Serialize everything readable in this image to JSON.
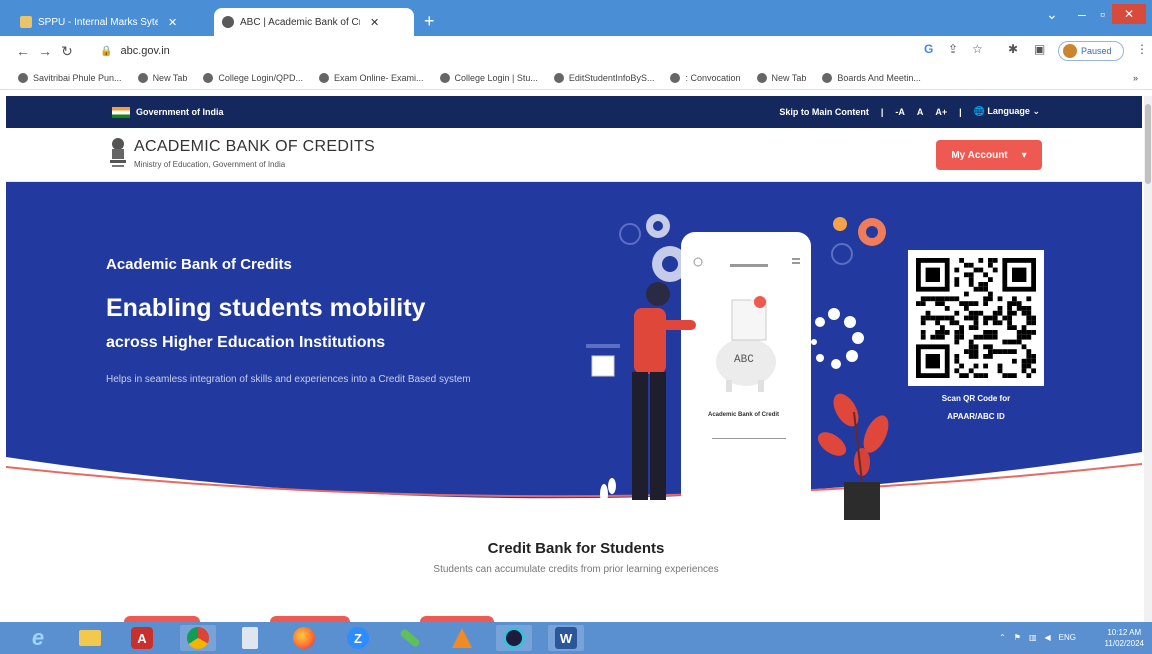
{
  "browser": {
    "tabs": [
      {
        "title": "SPPU - Internal Marks Sytem",
        "close": "✕"
      },
      {
        "title": "ABC | Academic Bank of Credits",
        "close": "✕"
      }
    ],
    "new_tab": "+",
    "url": "abc.gov.in",
    "profile_label": "Paused",
    "bookmarks": [
      "Savitribai Phule Pun...",
      "New Tab",
      "College Login/QPD...",
      "Exam Online- Exami...",
      "College Login | Stu...",
      "EditStudentInfoByS...",
      ": Convocation",
      "New Tab",
      "Boards And Meetin..."
    ],
    "bookmarks_more": "»"
  },
  "gov_bar": {
    "label": "Government of India",
    "skip": "Skip to Main Content",
    "sep": "|",
    "font_small": "-A",
    "font_normal": "A",
    "font_large": "A+",
    "language": "Language"
  },
  "header": {
    "title": "ACADEMIC BANK OF CREDITS",
    "subtitle": "Ministry of Education, Government of India",
    "account_button": "My Account"
  },
  "hero": {
    "kicker": "Academic Bank of Credits",
    "headline": "Enabling students mobility",
    "subheadline": "across Higher Education Institutions",
    "description": "Helps in seamless integration of skills and experiences into a Credit Based system",
    "phone_piggy_label": "ABC",
    "phone_caption": "Academic Bank of Credit",
    "badge": "$",
    "qr_caption_line1": "Scan QR Code for",
    "qr_caption_line2": "APAAR/ABC ID"
  },
  "section": {
    "title": "Credit Bank for Students",
    "subtitle": "Students can accumulate credits from prior learning experiences"
  },
  "taskbar": {
    "lang": "ENG",
    "time": "10:12 AM",
    "date": "11/02/2024",
    "apps": [
      "e",
      "",
      "A",
      "",
      "",
      "",
      "Z",
      "",
      "",
      "",
      "W"
    ]
  },
  "colors": {
    "gov_bar": "#14285e",
    "hero_bg": "#223a9f",
    "accent": "#ee5a52",
    "tabstrip": "#4a8fd6",
    "taskbar": "#5a8fd0"
  }
}
